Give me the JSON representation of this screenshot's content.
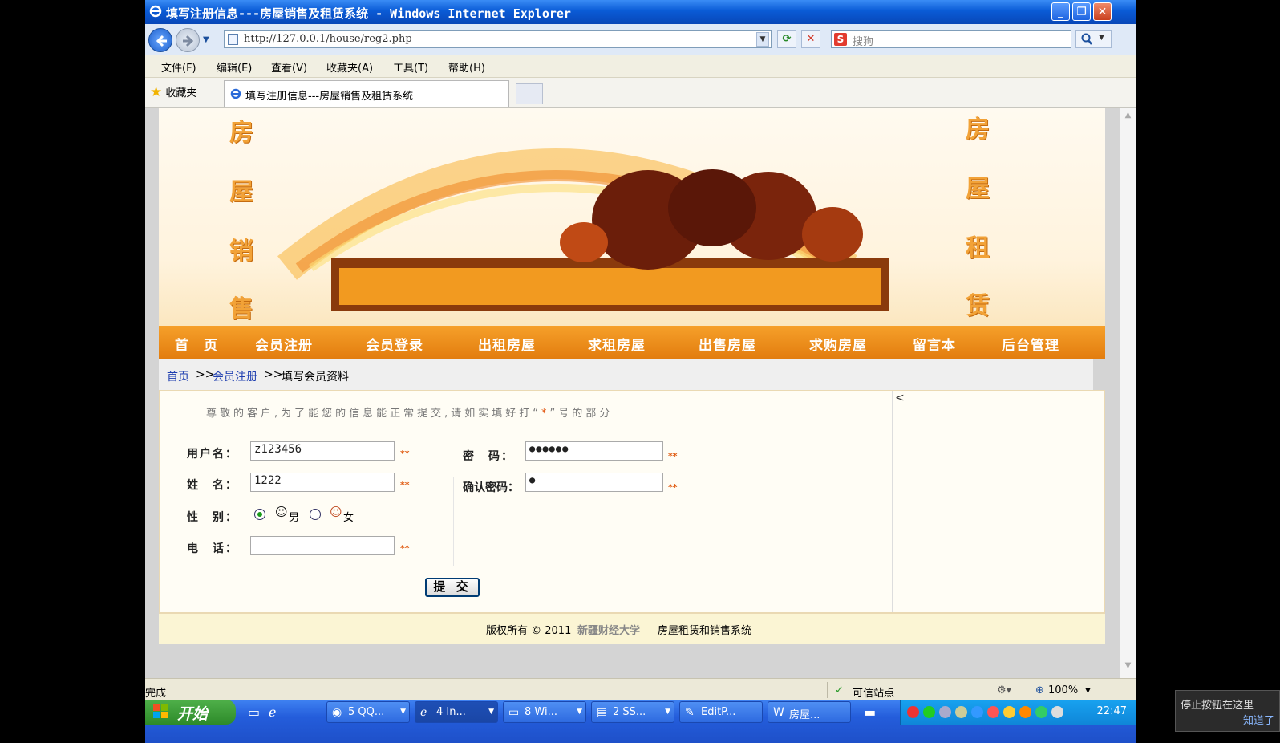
{
  "window": {
    "title": "填写注册信息---房屋销售及租赁系统 - Windows Internet Explorer",
    "min_label": "_",
    "max_label": "❐",
    "close_label": "✕"
  },
  "address": {
    "url": "http://127.0.0.1/house/reg2.php"
  },
  "search": {
    "placeholder": "搜狗",
    "logo": "S"
  },
  "menu": [
    "文件(F)",
    "编辑(E)",
    "查看(V)",
    "收藏夹(A)",
    "工具(T)",
    "帮助(H)"
  ],
  "favorites": {
    "label": "收藏夹"
  },
  "tab": {
    "title": "填写注册信息---房屋销售及租赁系统"
  },
  "banner": {
    "left_chars": [
      "房",
      "屋",
      "销",
      "售"
    ],
    "right_chars": [
      "房",
      "屋",
      "租",
      "赁"
    ]
  },
  "nav": [
    "首　页",
    "会员注册",
    "会员登录",
    "出租房屋",
    "求租房屋",
    "出售房屋",
    "求购房屋",
    "留言本",
    "后台管理"
  ],
  "breadcrumb": {
    "home": "首页",
    "sep": ">>",
    "register": "会员注册",
    "current": "填写会员资料"
  },
  "form": {
    "notice_pre": "尊敬的客户,为了能您的信息能正常提交,请如实填好打“",
    "notice_star": "*",
    "notice_post": "”号的部分",
    "username_label": "用户名：",
    "username_value": "z123456",
    "name_label": "姓　名：",
    "name_value": "1222",
    "gender_label": "性　别：",
    "male_label": "男",
    "female_label": "女",
    "phone_label": "电　话：",
    "phone_value": "",
    "password_label": "密　码：",
    "password_value": "●●●●●●",
    "confirm_label": "确认密码：",
    "confirm_value": "●",
    "required_mark": "**",
    "submit_label": "提 交",
    "side_arrow": "<"
  },
  "footer": {
    "pre": "版权所有 © 2011",
    "org": "新疆财经大学",
    "post": "房屋租赁和销售系统"
  },
  "status": {
    "done": "完成",
    "zone": "可信站点",
    "zoom": "100%"
  },
  "taskbar": {
    "start": "开始",
    "items": [
      "5 QQ...",
      "4 In...",
      "8 Wi...",
      "2 SS...",
      "EditP...",
      "房屋..."
    ],
    "clock": "22:47"
  },
  "tooltip": {
    "text": "停止按钮在这里",
    "link": "知道了"
  },
  "colors": {
    "nav_orange": "#e88715",
    "title_blue": "#0a5bd6",
    "link_blue": "#1f3fb0",
    "required_red": "#e05a10"
  }
}
